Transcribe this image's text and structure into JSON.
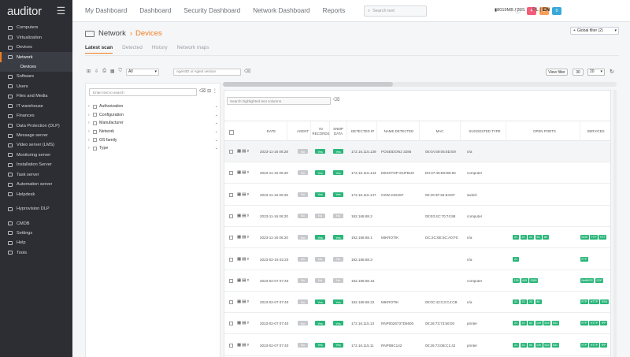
{
  "brand": "auditor",
  "sidebar": {
    "items": [
      {
        "label": "Computers"
      },
      {
        "label": "Virtualization"
      },
      {
        "label": "Devices"
      },
      {
        "label": "Network",
        "active": true
      },
      {
        "label": "Devices",
        "sub": true
      },
      {
        "label": "Software"
      },
      {
        "label": "Users"
      },
      {
        "label": "Files and Media"
      },
      {
        "label": "IT warehouse"
      },
      {
        "label": "Finances"
      },
      {
        "label": "Data Protection (DLP)"
      },
      {
        "label": "Message server"
      },
      {
        "label": "Video server (LMS)"
      },
      {
        "label": "Monitoring server"
      },
      {
        "label": "Installation Server"
      },
      {
        "label": "Task server"
      },
      {
        "label": "Automation server"
      },
      {
        "label": "Helpdesk"
      },
      {
        "gap": true
      },
      {
        "label": "Hyprovision DLP"
      },
      {
        "gap": true
      },
      {
        "label": "CMDB"
      },
      {
        "label": "Settings"
      },
      {
        "label": "Help"
      },
      {
        "label": "Tools"
      }
    ]
  },
  "topnav": [
    "My Dashboard",
    "Dashboard",
    "Security Dashboard",
    "Network Dashboard",
    "Reports"
  ],
  "search": {
    "placeholder": "Search text"
  },
  "badges": [
    {
      "label": "4",
      "color": "#f25c78"
    },
    {
      "label": "0",
      "color": "#f5a05a"
    },
    {
      "label": "0",
      "color": "#3aa9d9"
    }
  ],
  "memory": "8019MB / 30S",
  "lang": {
    "pl": "PL",
    "en": "EN"
  },
  "page": {
    "section": "Network",
    "current": "Devices"
  },
  "global_filter": "Global filter (2)",
  "tabs": [
    {
      "label": "Latest scan",
      "active": true
    },
    {
      "label": "Detected"
    },
    {
      "label": "History"
    },
    {
      "label": "Network maps"
    }
  ],
  "filter": {
    "select": "All",
    "agent_placeholder": "AgentID or Agent version"
  },
  "view_filter": "View filter",
  "page_size_a": "30",
  "page_size_b": "20",
  "tree": {
    "search_placeholder": "Enter text to search",
    "items": [
      "Authorization",
      "Configuration",
      "Manufacturer",
      "Network",
      "OS family",
      "Type"
    ]
  },
  "table": {
    "search_placeholder": "Search highlighted text columns",
    "columns": [
      "DATE",
      "AGENT",
      "IN RECORDS",
      "SNMP DATA",
      "DETECTED IP",
      "NAME DETECTED",
      "MAC",
      "SUGGESTED TYPE",
      "OPEN PORTS",
      "SERVICES"
    ],
    "rows": [
      {
        "date": "2023-11-16 06:28",
        "agent": "No",
        "records": "Yes",
        "snmp": "Yes",
        "ip": "172.16.115.139",
        "name": "POSEIDON2 3286",
        "mac": "00:0A:59:05:6D:E9",
        "type": "n/a",
        "ports": [],
        "services": []
      },
      {
        "date": "2023-11-16 06:20",
        "agent": "No",
        "records": "Yes",
        "snmp": "Yes",
        "ip": "172.16.115.144",
        "name": "DESKTOP-DUFBU0",
        "mac": "D0:37:45:E8:B0:94",
        "type": "computer",
        "ports": [],
        "services": []
      },
      {
        "date": "2023-11-16 06:25",
        "agent": "No",
        "records": "Yes",
        "snmp": "Yes",
        "ip": "172.16.115.147",
        "name": "GSW-2404SF",
        "mac": "00:20:4F:84:84:EF",
        "type": "switch",
        "ports": [],
        "services": []
      },
      {
        "date": "2023-11-16 06:20",
        "agent": "No",
        "records": "No",
        "snmp": "No",
        "ip": "192.168.88.2",
        "name": "",
        "mac": "00:E0:4C:70:74:88",
        "type": "computer",
        "ports": [],
        "services": []
      },
      {
        "date": "2023-11-16 06:20",
        "agent": "No",
        "records": "Yes",
        "snmp": "Yes",
        "ip": "192.168.88.1",
        "name": "MIKROTIK",
        "mac": "DC:2C:6E:5C:A0:F0",
        "type": "n/a",
        "ports": [
          "21",
          "22",
          "23",
          "53",
          "80"
        ],
        "services": [
          "DNS",
          "FTP",
          "HTT"
        ]
      },
      {
        "date": "2023-02-16 02:20",
        "agent": "No",
        "records": "No",
        "snmp": "No",
        "ip": "192.168.88.3",
        "name": "",
        "mac": "",
        "type": "n/a",
        "ports": [
          "21"
        ],
        "services": [
          "FTP"
        ]
      },
      {
        "date": "2023-02-07 07:40",
        "agent": "No",
        "records": "No",
        "snmp": "No",
        "ip": "192.168.88.16",
        "name": "",
        "mac": "",
        "type": "computer",
        "ports": [
          "139",
          "445",
          "3389"
        ],
        "services": [
          "NetBIOS",
          "SOP"
        ]
      },
      {
        "date": "2023-02-07 07:40",
        "agent": "No",
        "records": "Yes",
        "snmp": "Yes",
        "ip": "192.168.88.22",
        "name": "MIKROTIK",
        "mac": "00:0C:42:C3:C4:CB",
        "type": "n/a",
        "ports": [
          "21",
          "22",
          "23",
          "80"
        ],
        "services": [
          "FTP",
          "HTTP",
          "SSH"
        ]
      },
      {
        "date": "2023-02-07 07:40",
        "agent": "No",
        "records": "Yes",
        "snmp": "Yes",
        "ip": "172.16.115.13",
        "name": "RNP0026737D5600",
        "mac": "00:26:73:73:56:00",
        "type": "printer",
        "ports": [
          "21",
          "23",
          "80",
          "139",
          "515",
          "631"
        ],
        "services": [
          "FTP",
          "HTTP",
          "IPP"
        ]
      },
      {
        "date": "2023-02-07 07:40",
        "agent": "No",
        "records": "Yes",
        "snmp": "Yes",
        "ip": "172.16.115.11",
        "name": "RNP0BC142",
        "mac": "00:26:73:0B:C1:42",
        "type": "printer",
        "ports": [
          "21",
          "23",
          "80",
          "139",
          "515",
          "631"
        ],
        "services": [
          "FTP",
          "HTTP",
          "IPP"
        ]
      }
    ]
  }
}
